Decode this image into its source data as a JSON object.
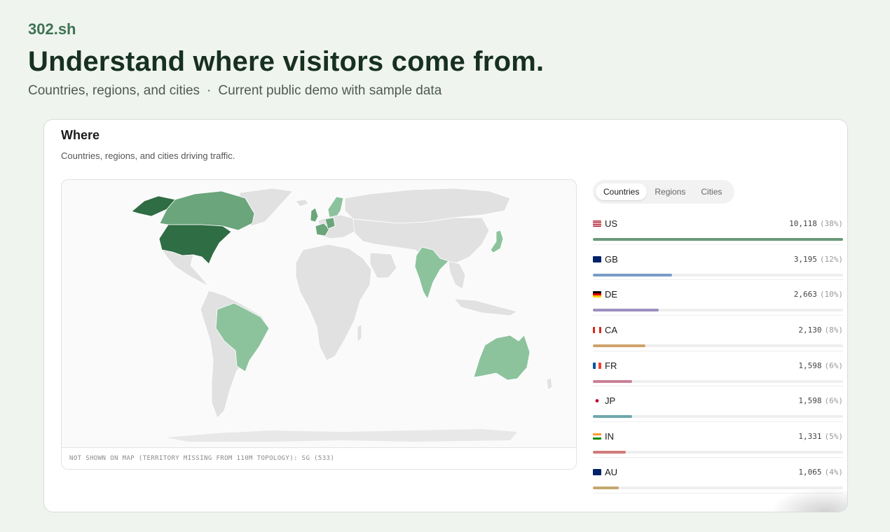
{
  "brand": "302.sh",
  "hero": {
    "title": "Understand where visitors come from.",
    "subtitle_left": "Countries, regions, and cities",
    "separator": "·",
    "subtitle_right": "Current public demo with sample data"
  },
  "card": {
    "title": "Where",
    "description": "Countries, regions, and cities driving traffic.",
    "map_footnote": "NOT SHOWN ON MAP (TERRITORY MISSING FROM 110M TOPOLOGY): SG (533)"
  },
  "tabs": [
    {
      "label": "Countries",
      "active": true
    },
    {
      "label": "Regions",
      "active": false
    },
    {
      "label": "Cities",
      "active": false
    }
  ],
  "colors": {
    "brand": "#3e7352",
    "map_high": "#2f6d44",
    "map_mid": "#6aa57c",
    "map_low": "#8cc39d",
    "map_none": "#e1e1e1"
  },
  "countries": [
    {
      "code": "US",
      "value": "10,118",
      "pct": "(38%)",
      "share": 1.0,
      "color": "#6b9a7a"
    },
    {
      "code": "GB",
      "value": "3,195",
      "pct": "(12%)",
      "share": 0.316,
      "color": "#7a9cc7"
    },
    {
      "code": "DE",
      "value": "2,663",
      "pct": "(10%)",
      "share": 0.263,
      "color": "#9c8fbf"
    },
    {
      "code": "CA",
      "value": "2,130",
      "pct": "(8%)",
      "share": 0.21,
      "color": "#cfa36d"
    },
    {
      "code": "FR",
      "value": "1,598",
      "pct": "(6%)",
      "share": 0.158,
      "color": "#c98095"
    },
    {
      "code": "JP",
      "value": "1,598",
      "pct": "(6%)",
      "share": 0.158,
      "color": "#6ea8ab"
    },
    {
      "code": "IN",
      "value": "1,331",
      "pct": "(5%)",
      "share": 0.132,
      "color": "#d07a7a"
    },
    {
      "code": "AU",
      "value": "1,065",
      "pct": "(4%)",
      "share": 0.105,
      "color": "#c4a870"
    }
  ]
}
